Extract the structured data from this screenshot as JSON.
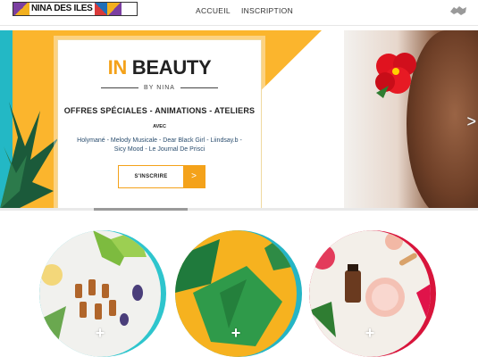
{
  "header": {
    "logo_text": "NINA DES ILES",
    "nav": [
      {
        "label": "ACCUEIL"
      },
      {
        "label": "INSCRIPTION"
      }
    ],
    "user_icon": "user-handshake-icon"
  },
  "hero": {
    "title_accent": "IN",
    "title_rest": "BEAUTY",
    "by": "BY NINA",
    "offers": "OFFRES SPÉCIALES - ANIMATIONS - ATELIERS",
    "avec": "AVEC",
    "names_line1": "Holymané - Melody Musicale - Dear Black Girl - Liindsay.b -",
    "names_line2": "Sicy Mood - Le Journal De Prisci",
    "cta_label": "S'INSCRIRE",
    "cta_arrow": ">",
    "next_arrow": ">",
    "slides": 3,
    "active_slide": 1
  },
  "tiles": [
    {
      "name": "serums",
      "icon": "plus-icon",
      "plus": "+"
    },
    {
      "name": "leaves",
      "icon": "plus-icon",
      "plus": "+"
    },
    {
      "name": "cosmetics",
      "icon": "plus-icon",
      "plus": "+"
    }
  ],
  "colors": {
    "accent_orange": "#f4a21a",
    "hero_yellow": "#fbb52d",
    "teal": "#2ec5cd",
    "crimson": "#d8143b",
    "active_dot": "#3a7ad8"
  }
}
